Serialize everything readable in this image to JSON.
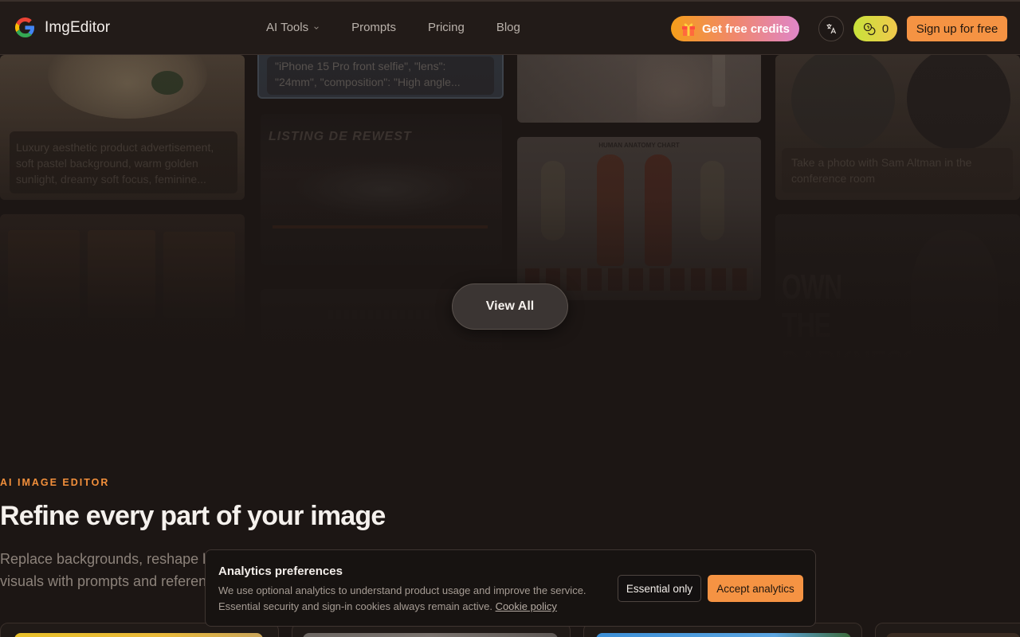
{
  "nav": {
    "brand": "ImgEditor",
    "links": [
      {
        "label": "AI Tools",
        "has_dropdown": true
      },
      {
        "label": "Prompts"
      },
      {
        "label": "Pricing"
      },
      {
        "label": "Blog"
      }
    ],
    "credits_label": "Get free credits",
    "coin_count": "0",
    "signup_label": "Sign up for free",
    "accent_color": "#f59343"
  },
  "gallery": {
    "captions": [
      "Luxury aesthetic product advertisement, soft pastel background, warm golden sunlight, dreamy soft focus, feminine...",
      "\"iPhone 15 Pro front selfie\", \"lens\": \"24mm\", \"composition\": \"High angle...",
      "Take a photo with Sam Altman in the conference room",
      "LISTING DE REWEST",
      "HUMAN ANATOMY CHART",
      "OWN THE DARKNESS"
    ],
    "view_all_label": "View All"
  },
  "section": {
    "eyebrow": "AI IMAGE EDITOR",
    "headline": "Refine every part of your image",
    "subline_visible_1": "Replace backgrounds, reshape li",
    "subline_visible_2": "visuals with prompts and referen"
  },
  "cookie": {
    "title": "Analytics preferences",
    "body_line1": "We use optional analytics to understand product usage and improve the service.",
    "body_line2": "Essential security and sign-in cookies always remain active.",
    "link_label": "Cookie policy",
    "essential_label": "Essential only",
    "accept_label": "Accept analytics"
  }
}
